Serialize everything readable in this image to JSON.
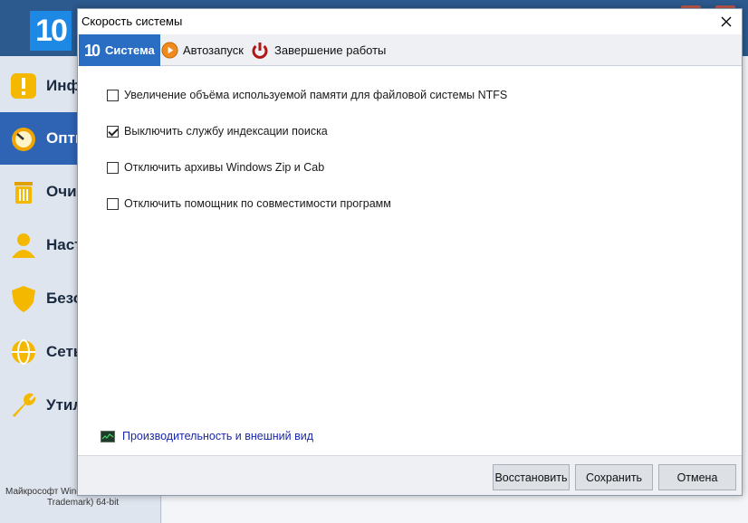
{
  "background_app": {
    "logo_text": "10",
    "sidebar": [
      {
        "label": "Инф",
        "icon": "info-icon",
        "color": "#f5b800"
      },
      {
        "label": "Опти",
        "icon": "speedometer-icon",
        "color": "#f0a500"
      },
      {
        "label": "Очис",
        "icon": "trash-bin-icon",
        "color": "#f5b800"
      },
      {
        "label": "Наст",
        "icon": "user-icon",
        "color": "#f5b800"
      },
      {
        "label": "Безо",
        "icon": "shield-icon",
        "color": "#f5b800"
      },
      {
        "label": "Сеть",
        "icon": "globe-icon",
        "color": "#f5b800"
      },
      {
        "label": "Утил",
        "icon": "wrench-icon",
        "color": "#f5b800"
      }
    ],
    "footer_line1": "Майкрософт Windo",
    "footer_line2": "Trademark) 64-bit"
  },
  "dialog": {
    "title": "Скорость системы",
    "tabs": [
      {
        "label": "Система",
        "icon": "windows10-logo-icon",
        "active": true
      },
      {
        "label": "Автозапуск",
        "icon": "play-icon",
        "active": false
      },
      {
        "label": "Завершение работы",
        "icon": "power-icon",
        "active": false
      }
    ],
    "options": [
      {
        "label": "Увеличение объёма используемой памяти для файловой системы NTFS",
        "checked": false
      },
      {
        "label": "Выключить службу индексации поиска",
        "checked": true
      },
      {
        "label": "Отключить архивы Windows Zip и Cab",
        "checked": false
      },
      {
        "label": "Отключить помощник по совместимости программ",
        "checked": false
      }
    ],
    "perf_link": "Производительность и внешний вид",
    "buttons": {
      "restore": "Восстановить",
      "save": "Сохранить",
      "cancel": "Отмена"
    }
  },
  "colors": {
    "accent": "#2a6ec4",
    "link": "#1a28a8"
  }
}
